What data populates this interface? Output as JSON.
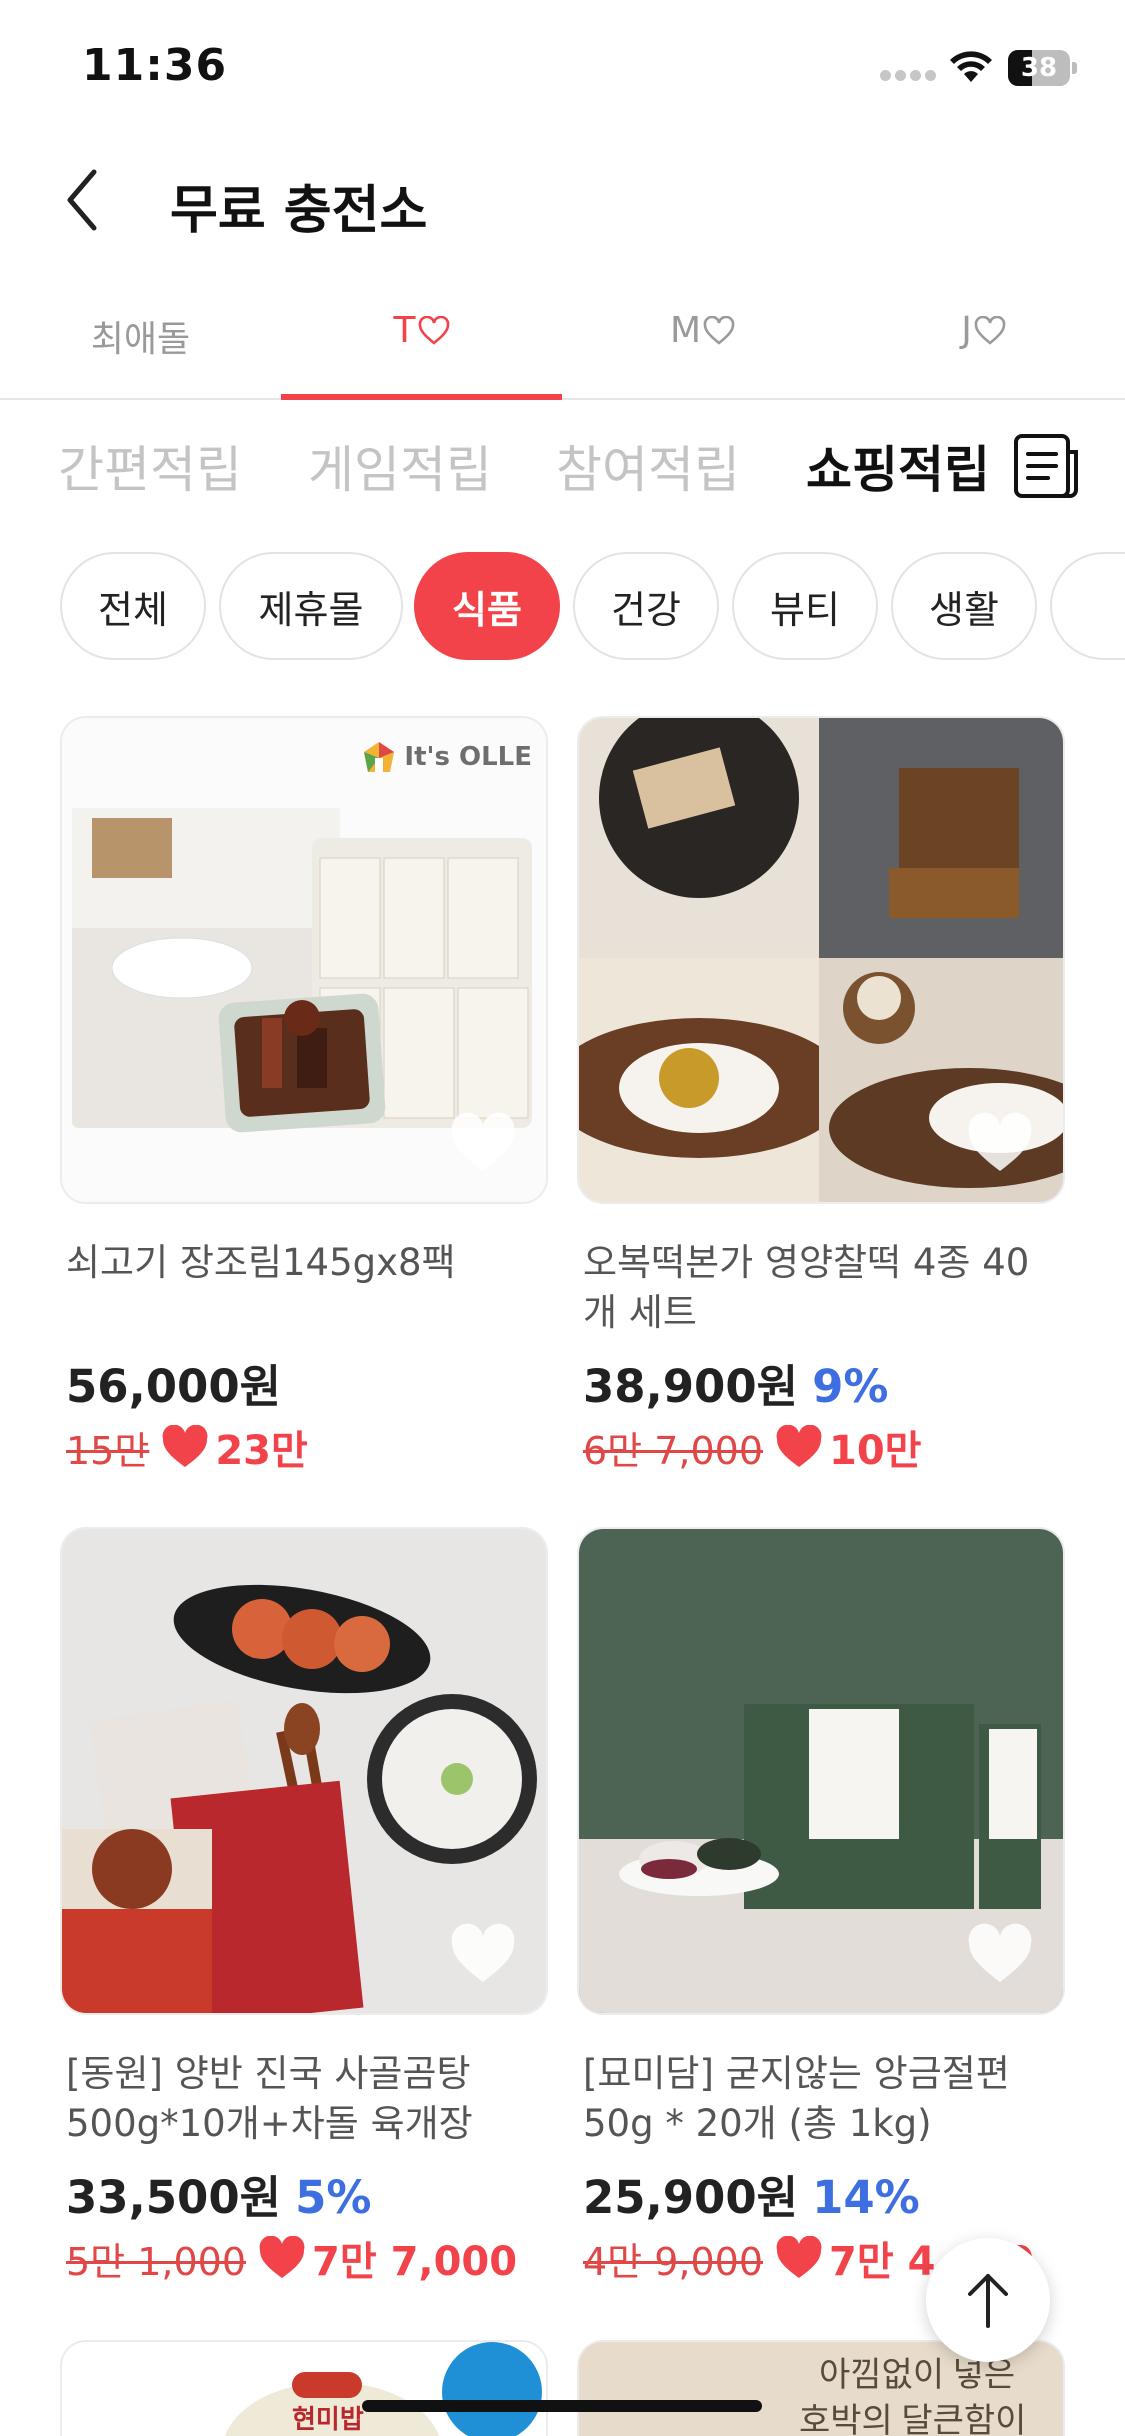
{
  "status_bar": {
    "time": "11:36",
    "battery": "38"
  },
  "header": {
    "title": "무료 충전소"
  },
  "idol_tabs": [
    {
      "label": "최애돌",
      "heart": false
    },
    {
      "label": "T",
      "heart": true
    },
    {
      "label": "M",
      "heart": true
    },
    {
      "label": "J",
      "heart": true
    }
  ],
  "category_tabs": [
    "간편적립",
    "게임적립",
    "참여적립",
    "쇼핑적립"
  ],
  "filter_chips": [
    "전체",
    "제휴몰",
    "식품",
    "건강",
    "뷰티",
    "생활"
  ],
  "products": [
    {
      "name": "쇠고기 장조림145gx8팩",
      "price": "56,000원",
      "discount": "",
      "original": "15만",
      "reward": "23만",
      "brand": "It's OLLE"
    },
    {
      "name": "오복떡본가 영양찰떡 4종 40개 세트",
      "price": "38,900원",
      "discount": "9%",
      "original": "6만 7,000",
      "reward": "10만"
    },
    {
      "name": "[동원] 양반 진국 사골곰탕 500g*10개+차돌 육개장",
      "price": "33,500원",
      "discount": "5%",
      "original": "5만 1,000",
      "reward": "7만 7,000"
    },
    {
      "name": "[묘미담] 굳지않는 앙금절편 50g * 20개 (총 1kg)",
      "price": "25,900원",
      "discount": "14%",
      "original": "4만 9,000",
      "reward": "7만 4,000"
    }
  ],
  "peek": {
    "left_label": "현미밥",
    "right_line1": "아낌없이 넣은",
    "right_line2": "호박의 달큰함이"
  },
  "colors": {
    "accent": "#f2424a",
    "discount_blue": "#3e6fe0"
  }
}
